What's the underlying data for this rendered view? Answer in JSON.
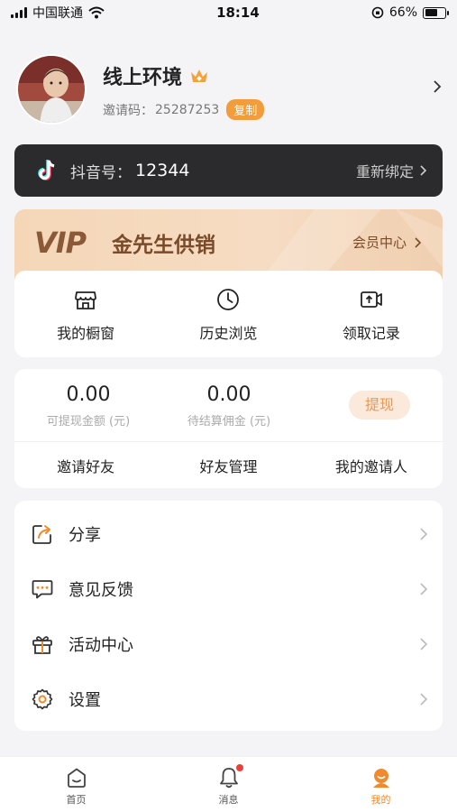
{
  "status_bar": {
    "carrier": "中国联通",
    "time": "18:14",
    "battery": "66%",
    "battery_level": 0.66
  },
  "profile": {
    "nickname": "线上环境",
    "invite_label": "邀请码：",
    "invite_code": "25287253",
    "copy_label": "复制"
  },
  "douyin": {
    "label": "抖音号：",
    "id": "12344",
    "rebind_label": "重新绑定"
  },
  "vip": {
    "logo": "VIP",
    "title": "金先生供销",
    "center_label": "会员中心"
  },
  "shortcuts": [
    {
      "label": "我的橱窗",
      "icon": "storefront-icon"
    },
    {
      "label": "历史浏览",
      "icon": "clock-icon"
    },
    {
      "label": "领取记录",
      "icon": "video-upload-icon"
    }
  ],
  "wallet": {
    "withdrawable_amount": "0.00",
    "withdrawable_label": "可提现金额 (元)",
    "pending_amount": "0.00",
    "pending_label": "待结算佣金 (元)",
    "withdraw_label": "提现",
    "links": [
      "邀请好友",
      "好友管理",
      "我的邀请人"
    ]
  },
  "menu": [
    {
      "label": "分享",
      "icon": "share-icon"
    },
    {
      "label": "意见反馈",
      "icon": "feedback-icon"
    },
    {
      "label": "活动中心",
      "icon": "gift-icon"
    },
    {
      "label": "设置",
      "icon": "settings-icon"
    }
  ],
  "tabs": [
    {
      "label": "首页",
      "icon": "home-icon",
      "active": false
    },
    {
      "label": "消息",
      "icon": "bell-icon",
      "active": false,
      "badge": true
    },
    {
      "label": "我的",
      "icon": "profile-icon",
      "active": true
    }
  ],
  "colors": {
    "accent": "#f08a2c",
    "copy_button": "#f39c3c",
    "douyin_bar": "#2b2b2d",
    "vip_text": "#7a4b2a",
    "badge": "#e8403a"
  }
}
